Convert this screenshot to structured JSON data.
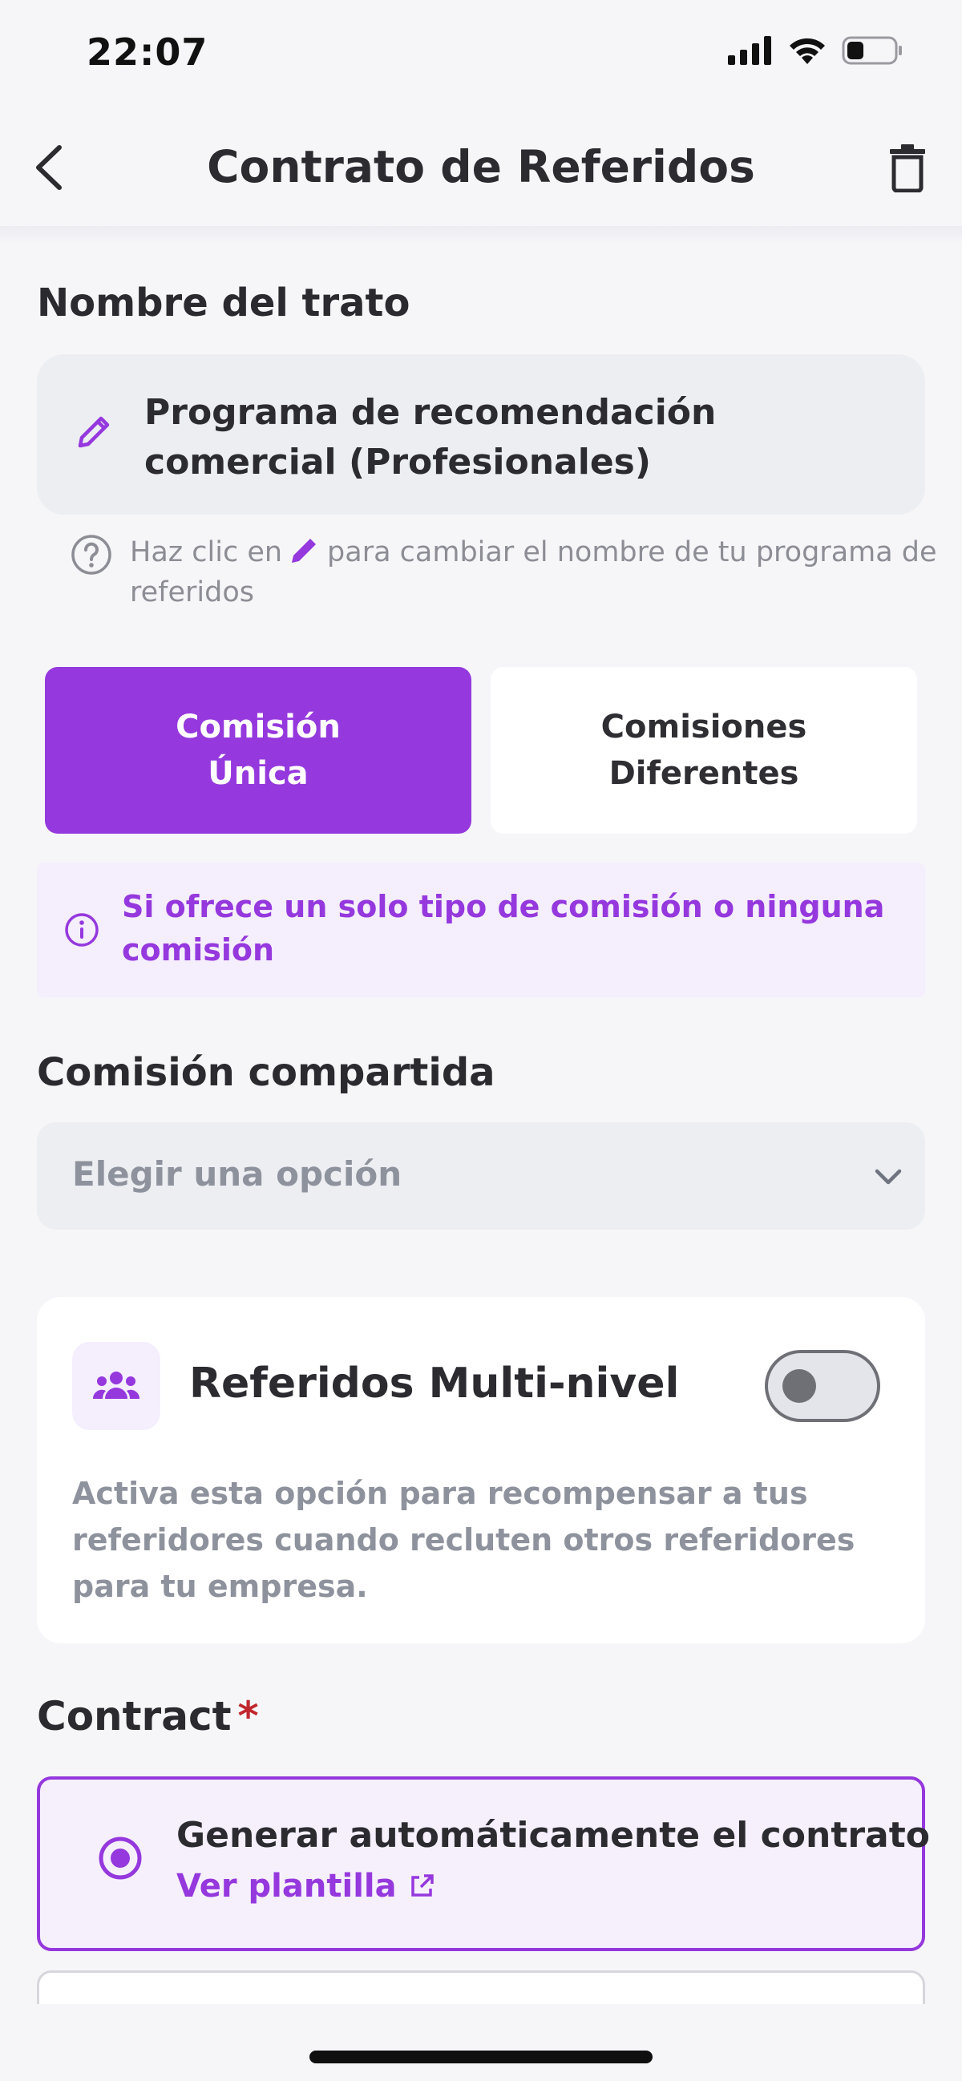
{
  "status_bar": {
    "time": "22:07",
    "icons": [
      "signal-icon",
      "wifi-icon",
      "battery-icon"
    ]
  },
  "header": {
    "title": "Contrato de Referidos",
    "back_icon": "chevron-left-icon",
    "delete_icon": "trash-icon"
  },
  "deal_name": {
    "label": "Nombre del trato",
    "value": "Programa de recomendación comercial (Profesionales)",
    "edit_icon": "pencil-icon",
    "help_prefix": "Haz clic en",
    "help_suffix": "para cambiar el nombre de tu programa de referidos"
  },
  "commission_mode": {
    "options": [
      {
        "label_line1": "Comisión",
        "label_line2": "Única",
        "selected": true
      },
      {
        "label_line1": "Comisiones",
        "label_line2": "Diferentes",
        "selected": false
      }
    ]
  },
  "info_banner": {
    "text": "Si ofrece un solo tipo de comisión o ninguna comisión"
  },
  "shared_commission": {
    "label": "Comisión compartida",
    "placeholder": "Elegir una opción"
  },
  "multi_level": {
    "title": "Referidos Multi-nivel",
    "enabled": false,
    "description": "Activa esta opción para recompensar a tus referidores cuando recluten otros referidores para tu empresa."
  },
  "contract": {
    "label": "Contract",
    "required_mark": "*",
    "options": [
      {
        "title": "Generar automáticamente el contrato",
        "link": "Ver plantilla",
        "selected": true
      }
    ]
  },
  "colors": {
    "accent": "#9538dd",
    "accent_light": "#f4eefd",
    "background": "#f6f6f9",
    "field": "#eceef2",
    "muted_text": "#8e929c",
    "required": "#c0262d"
  }
}
